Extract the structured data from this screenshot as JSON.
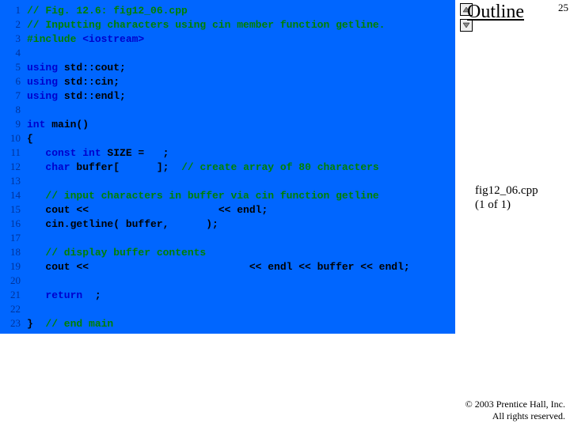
{
  "header": {
    "outline": "Outline",
    "page_number": "25"
  },
  "file": {
    "name": "fig12_06.cpp",
    "part": "(1 of 1)"
  },
  "copyright": {
    "line1": "© 2003 Prentice Hall, Inc.",
    "line2": "All rights reserved."
  },
  "code": {
    "l1": "// Fig. 12.6: fig12_06.cpp",
    "l2": "// Inputting characters using cin member function getline.",
    "l3a": "#include ",
    "l3b": "<iostream>",
    "l5a": "using ",
    "l5b": "std::cout;",
    "l6a": "using ",
    "l6b": "std::cin;",
    "l7a": "using ",
    "l7b": "std::endl;",
    "l9a": "int ",
    "l9b": "main()",
    "l10": "{",
    "l11a": "   const int ",
    "l11b": "SIZE = ",
    "l11c": ";",
    "l12a": "   char ",
    "l12b": "buffer[ ",
    "l12c": "];  ",
    "l12d": "// create array of 80 characters",
    "l14": "   // input characters in buffer via cin function getline",
    "l15": "   cout <<                     << endl;",
    "l16": "   cin.getline( buffer,      );",
    "l18": "   // display buffer contents",
    "l19": "   cout <<                          << endl << buffer << endl;",
    "l21a": "   return ",
    "l21b": ";",
    "l23a": "}  ",
    "l23b": "// end main"
  },
  "line_numbers": [
    "1",
    "2",
    "3",
    "4",
    "5",
    "6",
    "7",
    "8",
    "9",
    "10",
    "11",
    "12",
    "13",
    "14",
    "15",
    "16",
    "17",
    "18",
    "19",
    "20",
    "21",
    "22",
    "23"
  ]
}
